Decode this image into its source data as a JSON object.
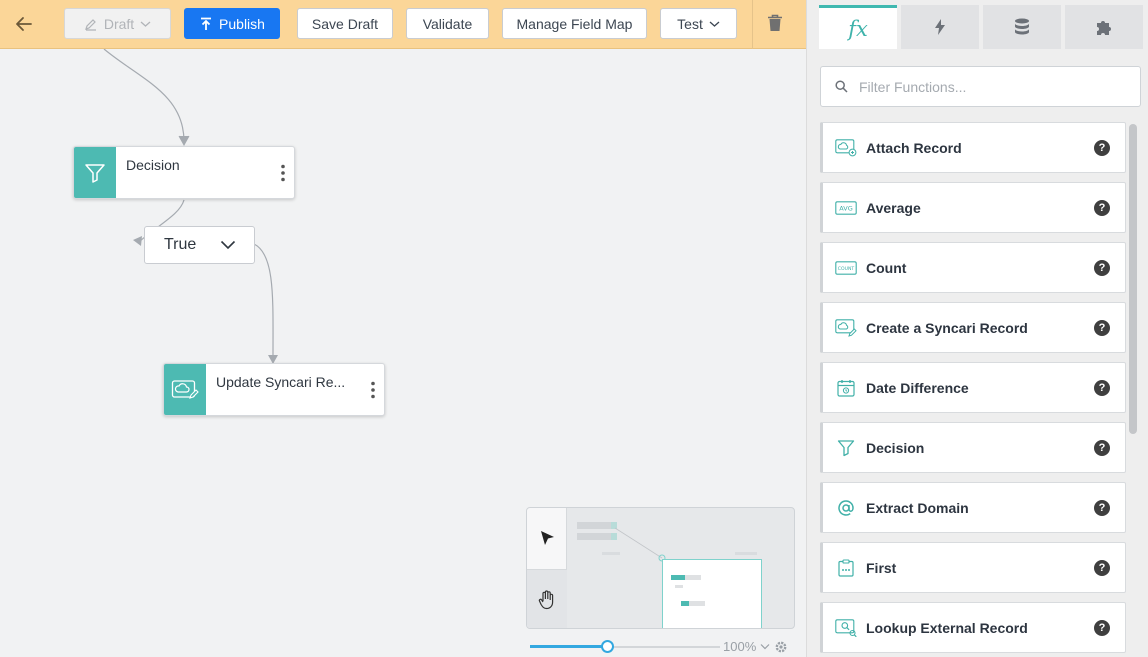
{
  "toolbar": {
    "draft_label": "Draft",
    "publish_label": "Publish",
    "save_draft_label": "Save Draft",
    "validate_label": "Validate",
    "manage_field_map_label": "Manage Field Map",
    "test_label": "Test",
    "back_icon": "arrow-left-icon",
    "trash_icon": "trash-icon"
  },
  "canvas": {
    "decision_node": {
      "title": "Decision",
      "icon": "funnel-icon"
    },
    "branch_select": {
      "value": "True"
    },
    "update_node": {
      "title": "Update Syncari Re...",
      "icon": "cloud-edit-icon"
    }
  },
  "minimap": {
    "zoom_label": "100%"
  },
  "panel": {
    "tabs": [
      {
        "name": "functions",
        "icon": "fx-icon",
        "glyph": "fx"
      },
      {
        "name": "triggers",
        "icon": "bolt-icon"
      },
      {
        "name": "data",
        "icon": "database-icon"
      },
      {
        "name": "plugins",
        "icon": "puzzle-icon"
      }
    ],
    "search_placeholder": "Filter Functions...",
    "functions": [
      {
        "label": "Attach Record",
        "icon": "attach-record-icon"
      },
      {
        "label": "Average",
        "icon": "avg-icon",
        "badge": "AVG"
      },
      {
        "label": "Count",
        "icon": "count-icon",
        "badge": "COUNT"
      },
      {
        "label": "Create a Syncari Record",
        "icon": "create-record-icon"
      },
      {
        "label": "Date Difference",
        "icon": "calendar-icon"
      },
      {
        "label": "Decision",
        "icon": "funnel-icon"
      },
      {
        "label": "Extract Domain",
        "icon": "at-sign-icon"
      },
      {
        "label": "First",
        "icon": "clipboard-icon"
      },
      {
        "label": "Lookup External Record",
        "icon": "lookup-icon"
      }
    ],
    "help_glyph": "?"
  },
  "colors": {
    "toolbar_bg": "#fbd698",
    "primary": "#1877f2",
    "accent": "#40b8b0"
  }
}
